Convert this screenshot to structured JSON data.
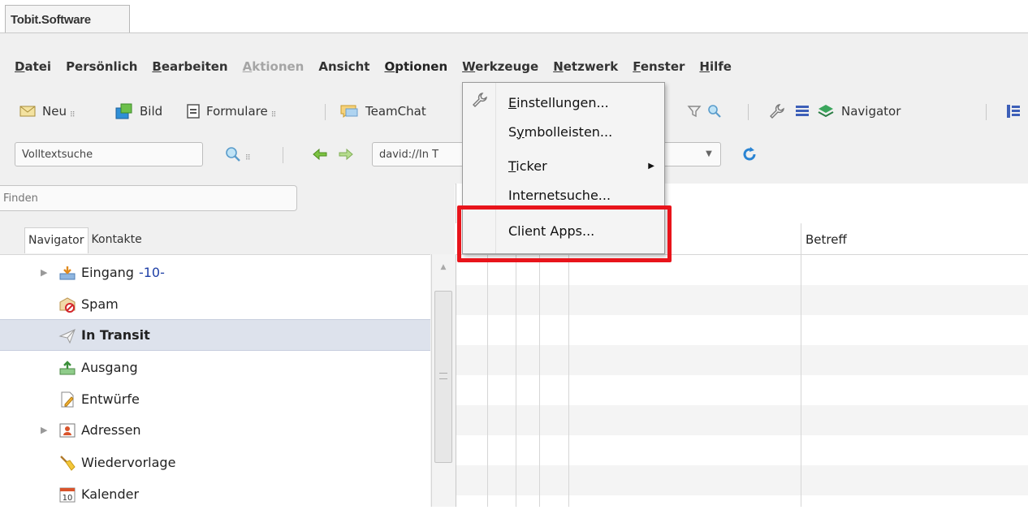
{
  "brand": "Tobit.Software",
  "menubar": [
    {
      "label": "Datei",
      "ul": "D",
      "state": "normal"
    },
    {
      "label": "Persönlich",
      "ul": "",
      "state": "normal"
    },
    {
      "label": "Bearbeiten",
      "ul": "B",
      "state": "normal"
    },
    {
      "label": "Aktionen",
      "ul": "A",
      "state": "disabled"
    },
    {
      "label": "Ansicht",
      "ul": "",
      "state": "normal"
    },
    {
      "label": "Optionen",
      "ul": "O",
      "state": "open"
    },
    {
      "label": "Werkzeuge",
      "ul": "W",
      "state": "normal"
    },
    {
      "label": "Netzwerk",
      "ul": "N",
      "state": "normal"
    },
    {
      "label": "Fenster",
      "ul": "F",
      "state": "normal"
    },
    {
      "label": "Hilfe",
      "ul": "H",
      "state": "normal"
    }
  ],
  "toolbar": {
    "neu": "Neu",
    "bild": "Bild",
    "formulare": "Formulare",
    "teamchat": "TeamChat",
    "navigator": "Navigator"
  },
  "search": {
    "value": "Volltextsuche"
  },
  "url": {
    "value": "david://In T"
  },
  "find": {
    "placeholder": "Finden"
  },
  "tabs": {
    "navigator": "Navigator",
    "kontakte": "Kontakte"
  },
  "tree": [
    {
      "label": "Eingang",
      "count": "-10-",
      "expander": true,
      "icon": "inbox-icon",
      "selected": false,
      "bold": false
    },
    {
      "label": "Spam",
      "count": "",
      "expander": false,
      "icon": "spam-icon",
      "selected": false,
      "bold": false
    },
    {
      "label": "In Transit",
      "count": "",
      "expander": false,
      "icon": "paper-plane-icon",
      "selected": true,
      "bold": true
    },
    {
      "label": "Ausgang",
      "count": "",
      "expander": false,
      "icon": "outbox-icon",
      "selected": false,
      "bold": false
    },
    {
      "label": "Entwürfe",
      "count": "",
      "expander": false,
      "icon": "draft-icon",
      "selected": false,
      "bold": false
    },
    {
      "label": "Adressen",
      "count": "",
      "expander": true,
      "icon": "contacts-icon",
      "selected": false,
      "bold": false
    },
    {
      "label": "Wiedervorlage",
      "count": "",
      "expander": false,
      "icon": "broom-icon",
      "selected": false,
      "bold": false
    },
    {
      "label": "Kalender",
      "count": "",
      "expander": false,
      "icon": "calendar-icon",
      "selected": false,
      "bold": false
    }
  ],
  "calendar_day": "10",
  "list": {
    "betreff": "Betreff"
  },
  "options_menu": [
    {
      "label": "Einstellungen...",
      "ul": "E",
      "submenu": false
    },
    {
      "label": "Symbolleisten...",
      "ul": "y",
      "submenu": false
    },
    {
      "label": "Ticker",
      "ul": "T",
      "submenu": true
    },
    {
      "label": "Internetsuche...",
      "ul": "",
      "submenu": false
    },
    {
      "label": "Client Apps...",
      "ul": "",
      "submenu": false
    }
  ],
  "colors": {
    "highlight": "#e8141b",
    "selection": "#dde2ec",
    "count": "#1e3fa6"
  }
}
